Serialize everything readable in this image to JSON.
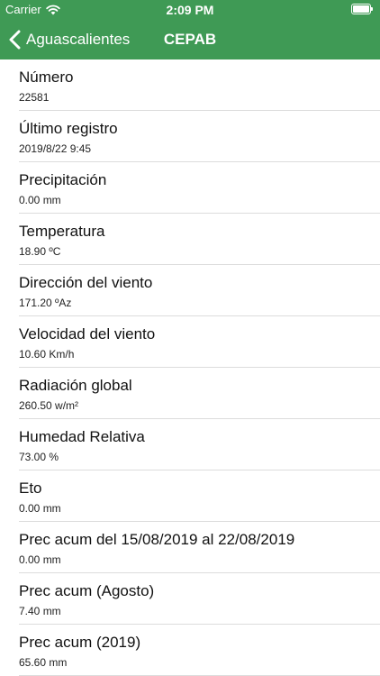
{
  "status_bar": {
    "carrier": "Carrier",
    "time": "2:09 PM",
    "battery_level": 1.0,
    "wifi_icon": "wifi-icon",
    "battery_icon": "battery-icon"
  },
  "nav": {
    "back_label": "Aguascalientes",
    "back_icon": "chevron-left-icon",
    "title": "CEPAB",
    "color": "#3f9a55"
  },
  "rows": [
    {
      "label": "Número",
      "value": "22581"
    },
    {
      "label": "Último registro",
      "value": "2019/8/22 9:45"
    },
    {
      "label": "Precipitación",
      "value": "0.00 mm"
    },
    {
      "label": "Temperatura",
      "value": "18.90 ºC"
    },
    {
      "label": "Dirección del viento",
      "value": "171.20 ºAz"
    },
    {
      "label": "Velocidad del viento",
      "value": "10.60 Km/h"
    },
    {
      "label": "Radiación global",
      "value": "260.50 w/m²"
    },
    {
      "label": "Humedad Relativa",
      "value": "73.00 %"
    },
    {
      "label": "Eto",
      "value": "0.00 mm"
    },
    {
      "label": "Prec acum del 15/08/2019 al 22/08/2019",
      "value": "0.00 mm"
    },
    {
      "label": "Prec acum (Agosto)",
      "value": "7.40 mm"
    },
    {
      "label": "Prec acum (2019)",
      "value": "65.60 mm"
    }
  ]
}
